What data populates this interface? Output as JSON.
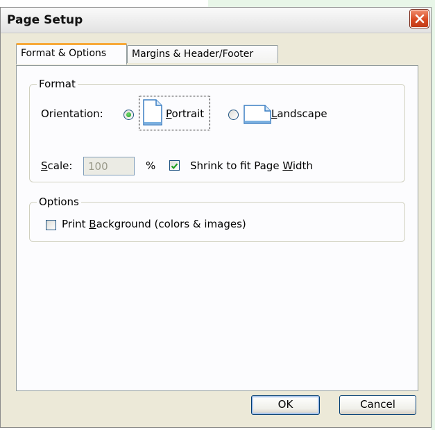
{
  "window": {
    "title": "Page Setup"
  },
  "tabs": [
    {
      "label": "Format & Options",
      "active": true
    },
    {
      "label": "Margins & Header/Footer",
      "active": false
    }
  ],
  "format_group": {
    "legend": "Format",
    "orientation_label": "Orientation:",
    "portrait": {
      "label_pre": "",
      "accel": "P",
      "label_post": "ortrait",
      "selected": true
    },
    "landscape": {
      "label_pre": "",
      "accel": "L",
      "label_post": "andscape",
      "selected": false
    },
    "scale_label_accel": "S",
    "scale_label_rest": "cale:",
    "scale_value": "100",
    "percent_sign": "%",
    "shrink": {
      "label_pre": "Shrink to fit Page ",
      "accel": "W",
      "label_post": "idth",
      "checked": true
    }
  },
  "options_group": {
    "legend": "Options",
    "print_background": {
      "label_pre": "Print ",
      "accel": "B",
      "label_post": "ackground (colors & images)",
      "checked": false
    }
  },
  "buttons": {
    "ok": "OK",
    "cancel": "Cancel"
  },
  "colors": {
    "close_button": "#d84a22",
    "active_tab_accent": "#f7a93a",
    "radio_dot": "#1f9a1f",
    "check_mark": "#21a121"
  }
}
